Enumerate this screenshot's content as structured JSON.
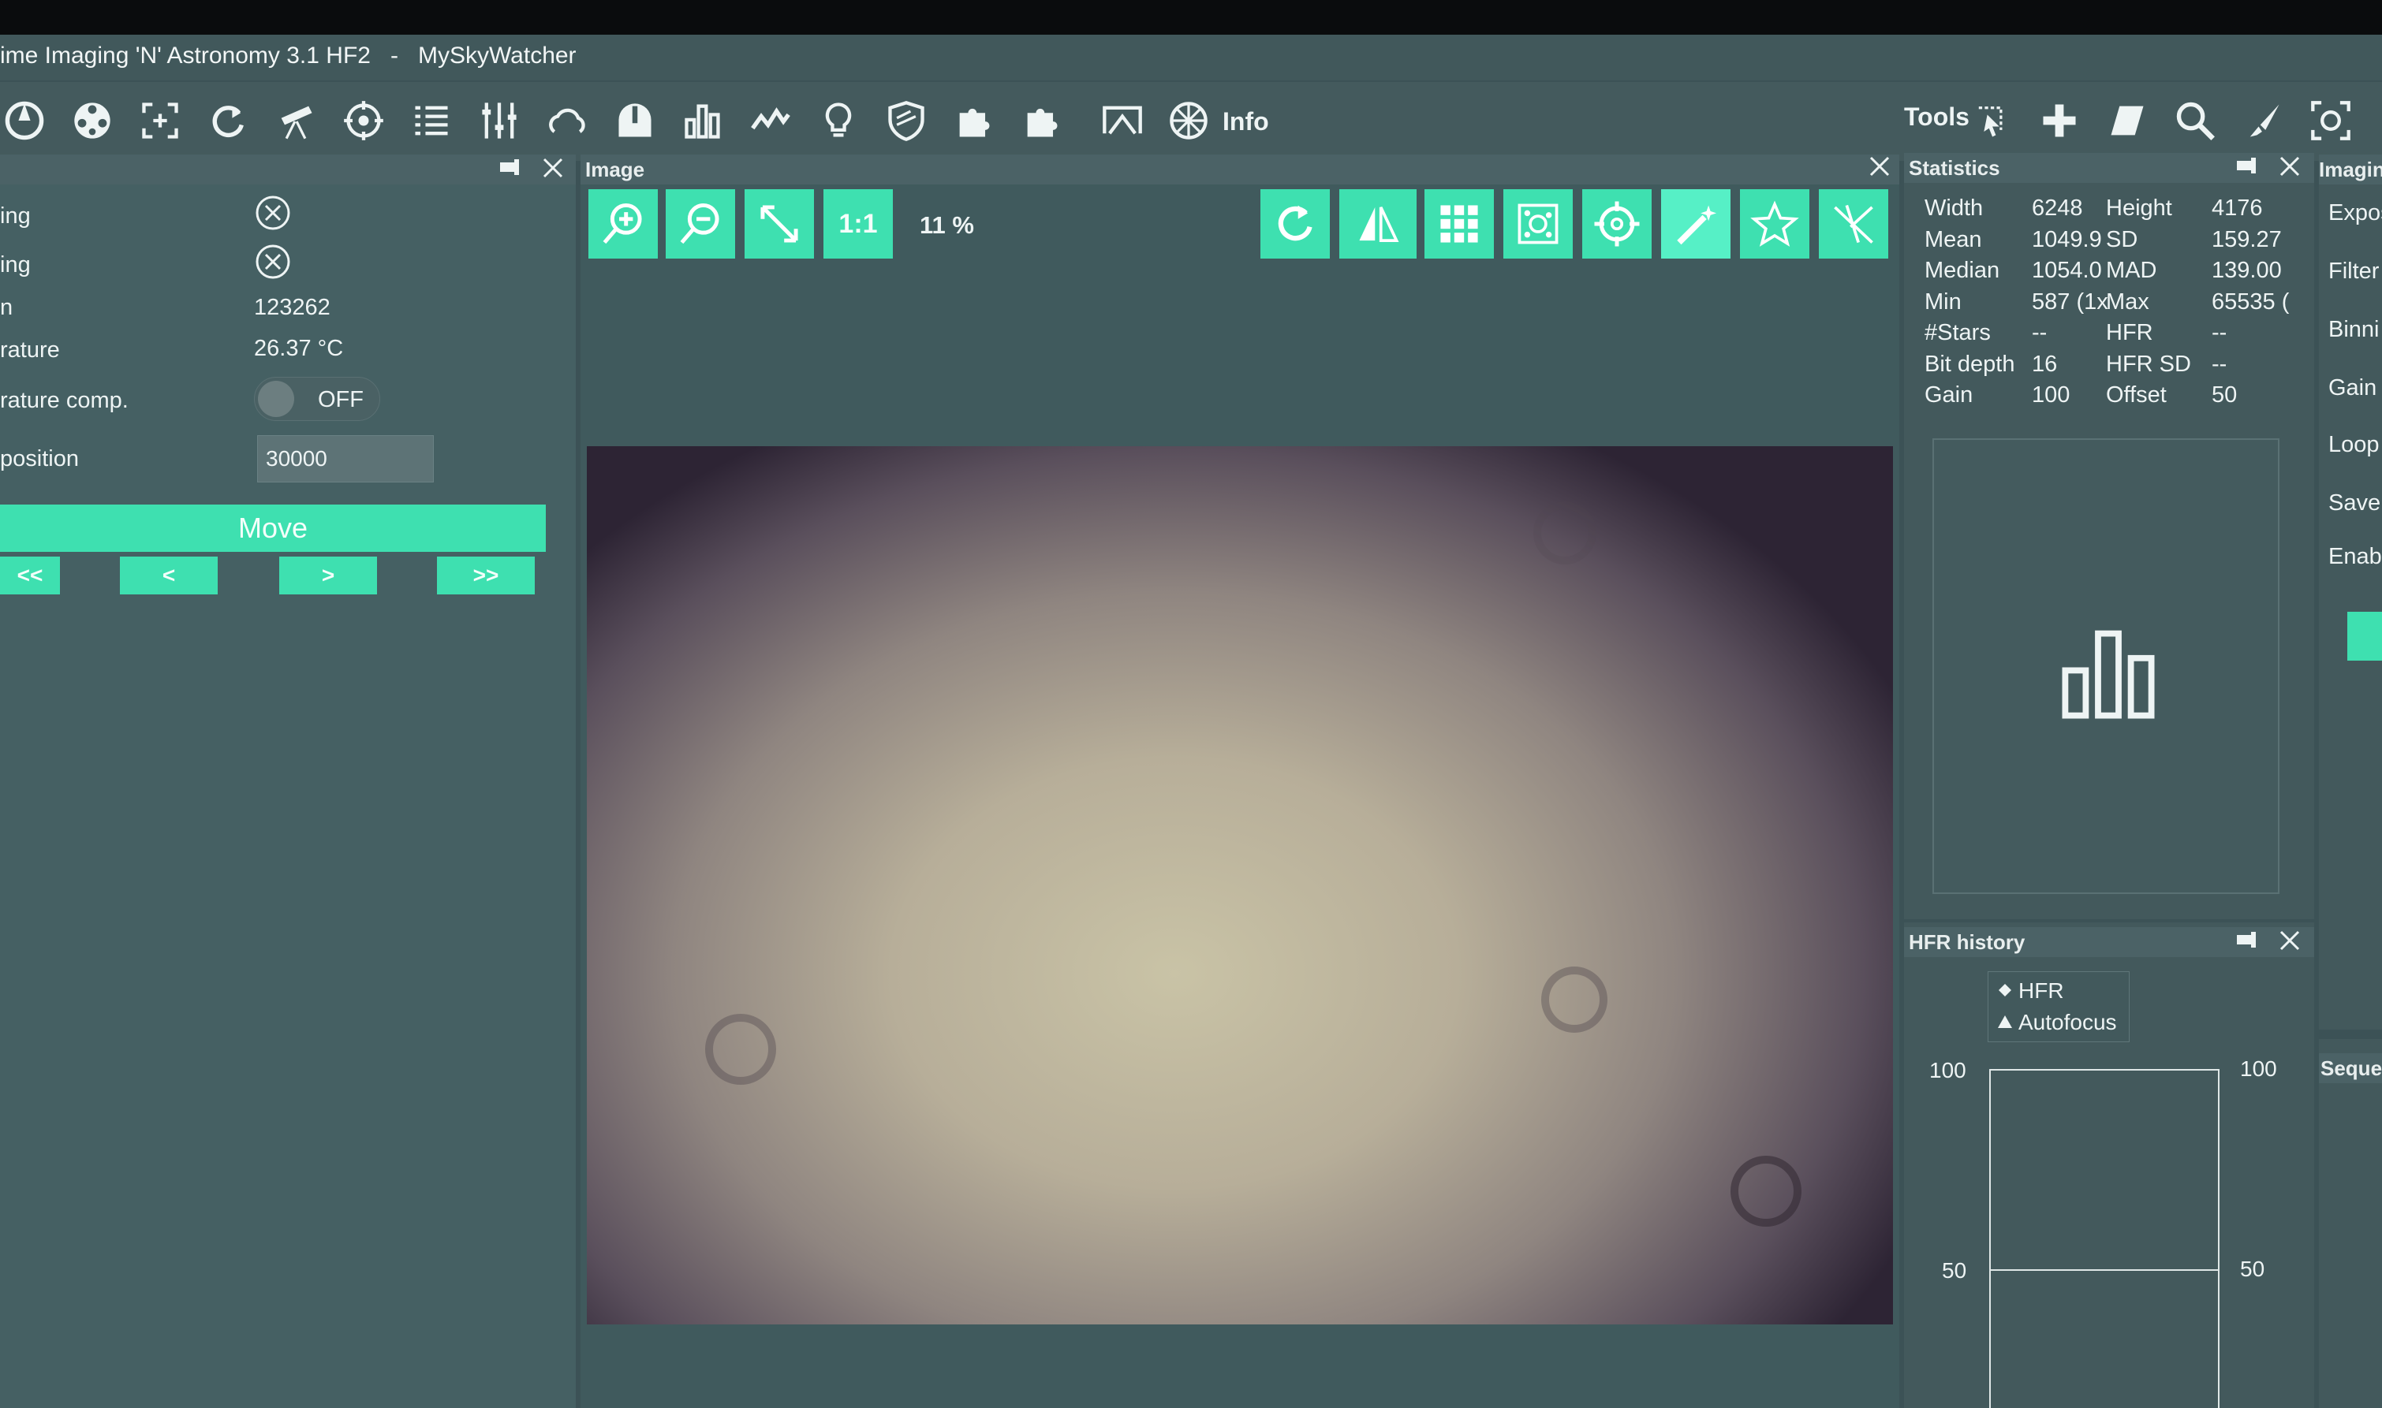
{
  "window": {
    "title": "ime Imaging 'N' Astronomy 3.1 HF2   -   MySkyWatcher"
  },
  "toolbar": {
    "info_label": "Info",
    "tools_label": "Tools"
  },
  "focuser": {
    "rows": [
      {
        "label": "ing",
        "value_icon": "circle-x-icon"
      },
      {
        "label": "ing",
        "value_icon": "circle-x-icon"
      },
      {
        "label": "n",
        "value": "123262"
      },
      {
        "label": "rature",
        "value": "26.37 °C"
      },
      {
        "label": "rature comp.",
        "toggle": "OFF"
      },
      {
        "label": "position",
        "input": "30000"
      }
    ],
    "move_label": "Move",
    "nav": [
      "<<",
      "<",
      ">",
      ">>"
    ]
  },
  "image_panel": {
    "title": "Image",
    "zoom": "11 %",
    "one_to_one": "1:1"
  },
  "statistics": {
    "title": "Statistics",
    "rows": [
      [
        "Width",
        "6248",
        "Height",
        "4176"
      ],
      [
        "Mean",
        "1049.9",
        "SD",
        "159.27"
      ],
      [
        "Median",
        "1054.0",
        "MAD",
        "139.00"
      ],
      [
        "Min",
        "587 (1x",
        "Max",
        "65535 ("
      ],
      [
        "#Stars",
        "--",
        "HFR",
        "--"
      ],
      [
        "Bit depth",
        "16",
        "HFR SD",
        "--"
      ],
      [
        "Gain",
        "100",
        "Offset",
        "50"
      ]
    ]
  },
  "hfr_history": {
    "title": "HFR history",
    "legend": [
      "HFR",
      "Autofocus"
    ],
    "y_left": [
      "100",
      "50"
    ],
    "y_right": [
      "100",
      "50"
    ]
  },
  "imaging": {
    "title": "Imagin",
    "items": [
      "Expos",
      "Filter",
      "Binni",
      "Gain",
      "Loop",
      "Save",
      "Enabl"
    ],
    "sequence_title": "Sequen"
  },
  "colors": {
    "accent": "#3ee0b0",
    "panel": "#415a5d",
    "header": "#4b6266"
  }
}
